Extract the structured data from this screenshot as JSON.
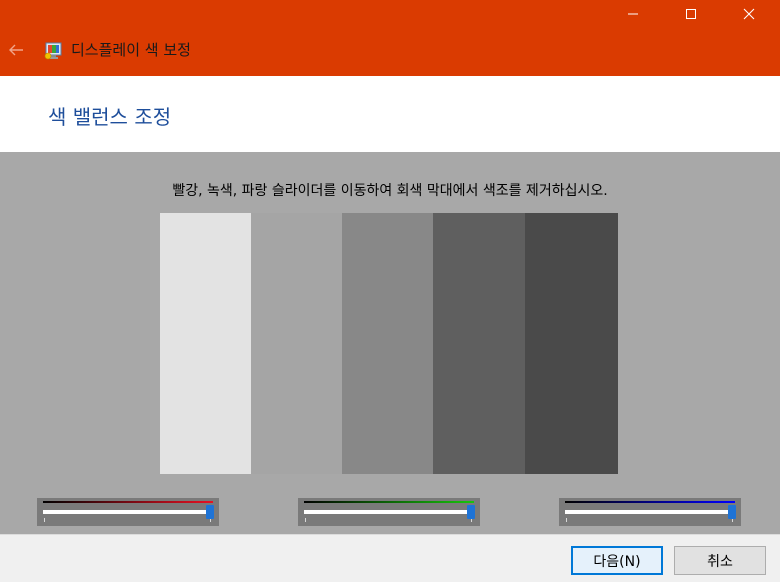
{
  "window": {
    "title": "디스플레이 색 보정",
    "titlebar_color": "#da3b01"
  },
  "header": {
    "title": "색 밸런스 조정"
  },
  "main": {
    "instruction": "빨강, 녹색, 파랑 슬라이더를 이동하여 회색 막대에서 색조를 제거하십시오.",
    "gray_bars": [
      "#e3e3e3",
      "#a5a5a5",
      "#888888",
      "#5f5f5f",
      "#4a4a4a"
    ]
  },
  "sliders": [
    {
      "name": "red",
      "color": "#e81123",
      "value_fraction": 1.0
    },
    {
      "name": "green",
      "color": "#16c60c",
      "value_fraction": 1.0
    },
    {
      "name": "blue",
      "color": "#0000ff",
      "value_fraction": 1.0
    }
  ],
  "footer": {
    "next_label": "다음(N)",
    "cancel_label": "취소"
  },
  "icons": [
    "back-arrow-icon",
    "display-color-icon",
    "minimize-icon",
    "maximize-icon",
    "close-icon"
  ]
}
